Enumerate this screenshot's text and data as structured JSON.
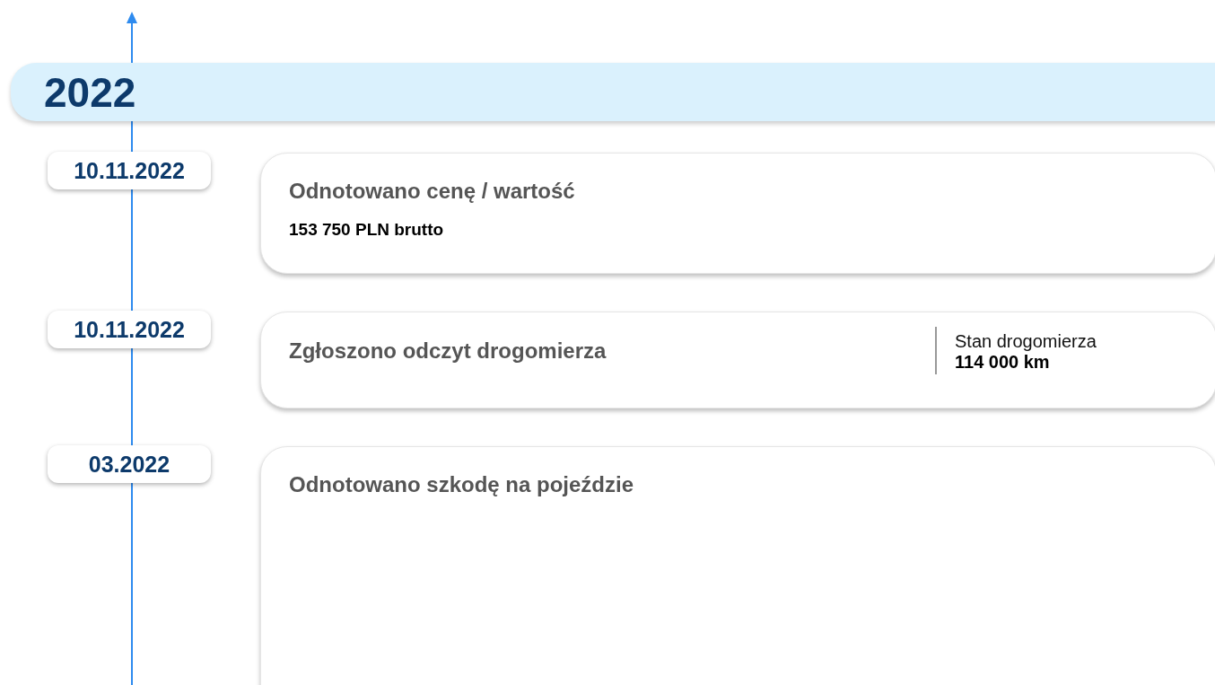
{
  "year": "2022",
  "events": [
    {
      "kind": "value",
      "date": "10.11.2022",
      "title": "Odnotowano cenę / wartość",
      "value": "153 750 PLN brutto"
    },
    {
      "kind": "odometer",
      "date": "10.11.2022",
      "title": "Zgłoszono odczyt drogomierza",
      "side_label": "Stan drogomierza",
      "side_value": "114 000 km"
    },
    {
      "kind": "plain",
      "date": "03.2022",
      "title": "Odnotowano szkodę na pojeździe"
    }
  ]
}
